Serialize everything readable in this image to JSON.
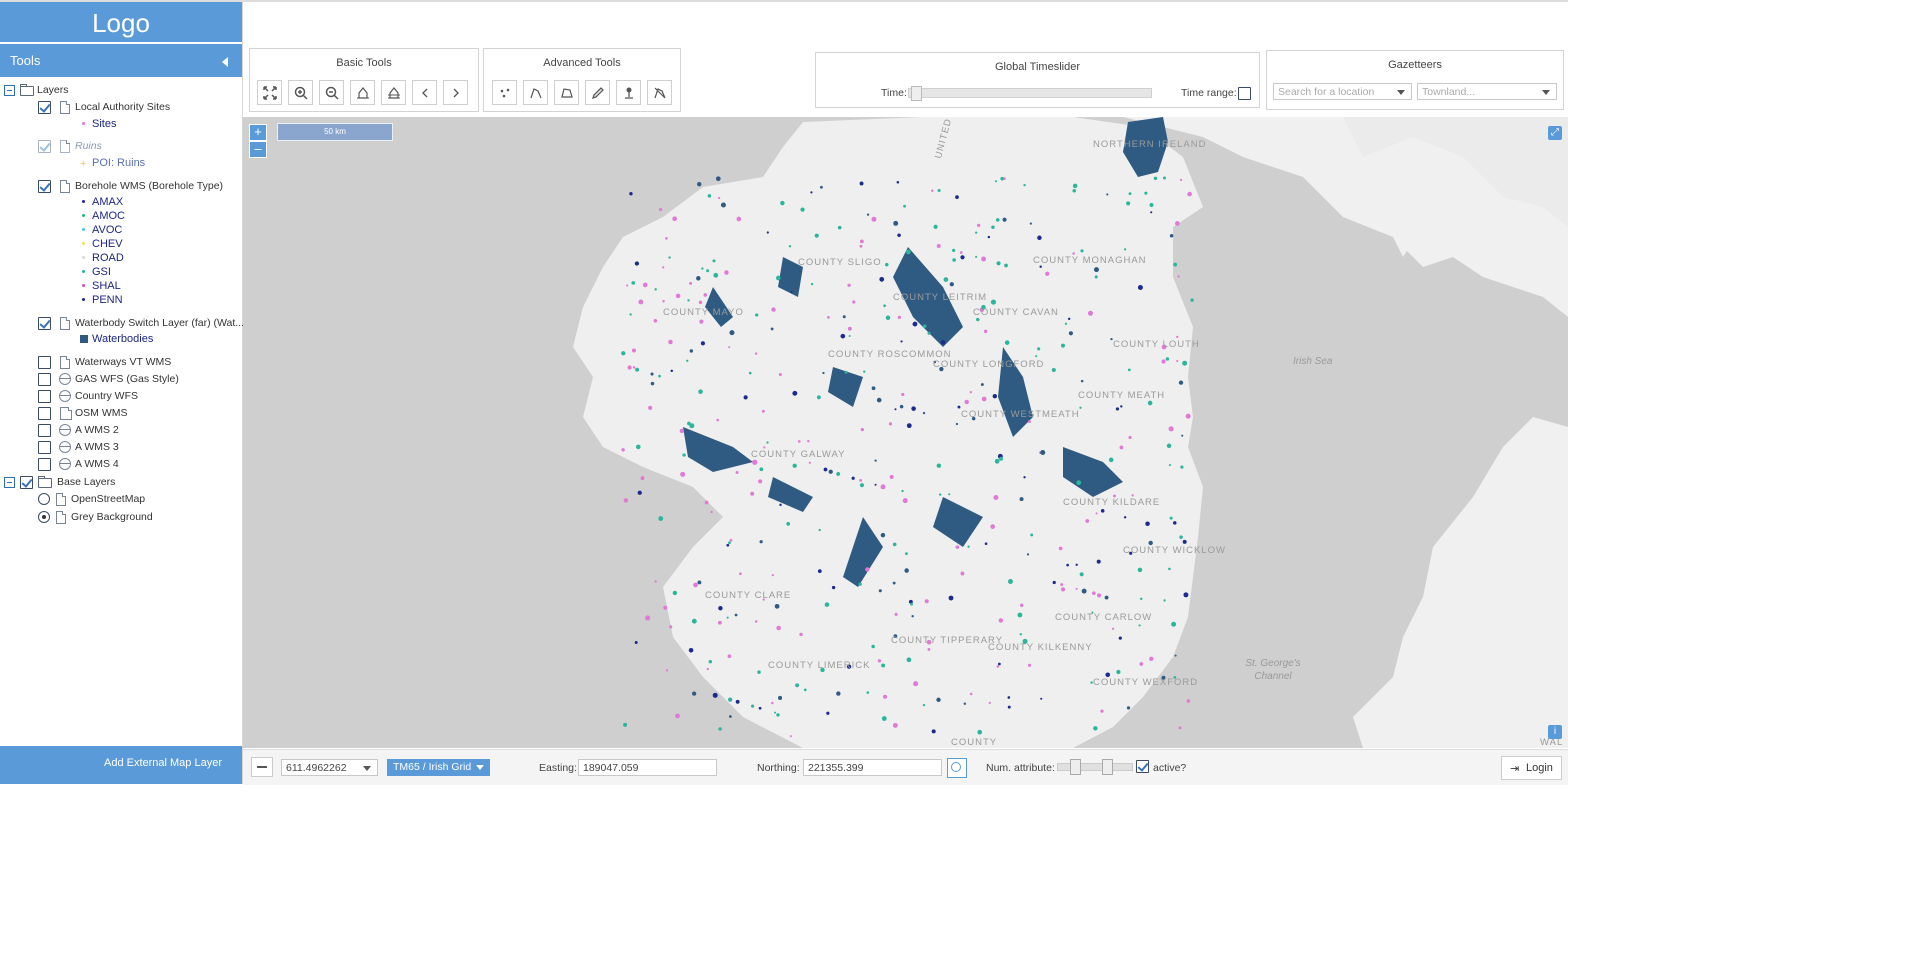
{
  "logo": "Logo",
  "sidebar": {
    "title": "Tools",
    "layers_group": "Layers",
    "layers": [
      {
        "label": "Local Authority Sites",
        "checked": true,
        "legend": [
          {
            "label": "Sites",
            "color": "#e07ad6",
            "shape": "dot"
          }
        ]
      },
      {
        "label": "Ruins",
        "checked": true,
        "dimmed": true,
        "legend": [
          {
            "label": "POI: Ruins",
            "color": "#e8c86a",
            "shape": "plus"
          }
        ]
      },
      {
        "label": "Borehole WMS (Borehole Type)",
        "checked": true,
        "legend": [
          {
            "label": "AMAX",
            "color": "#2e1f9a",
            "shape": "dot"
          },
          {
            "label": "AMOC",
            "color": "#26b872",
            "shape": "dot"
          },
          {
            "label": "AVOC",
            "color": "#47c8e0",
            "shape": "dot"
          },
          {
            "label": "CHEV",
            "color": "#f0e04a",
            "shape": "dot"
          },
          {
            "label": "ROAD",
            "color": "#d9d9d9",
            "shape": "dot"
          },
          {
            "label": "GSI",
            "color": "#2bb59c",
            "shape": "dot"
          },
          {
            "label": "SHAL",
            "color": "#d24fd0",
            "shape": "dot"
          },
          {
            "label": "PENN",
            "color": "#1b2a8c",
            "shape": "dot"
          }
        ]
      },
      {
        "label": "Waterbody Switch Layer (far) (Wat...",
        "checked": true,
        "legend": [
          {
            "label": "Waterbodies",
            "color": "#2f5b82",
            "shape": "square"
          }
        ]
      },
      {
        "label": "Waterways VT WMS",
        "checked": false,
        "icon": "doc"
      },
      {
        "label": "GAS WFS (Gas Style)",
        "checked": false,
        "icon": "globe"
      },
      {
        "label": "Country WFS",
        "checked": false,
        "icon": "globe"
      },
      {
        "label": "OSM WMS",
        "checked": false,
        "icon": "map"
      },
      {
        "label": "A WMS 2",
        "checked": false,
        "icon": "globe"
      },
      {
        "label": "A WMS 3",
        "checked": false,
        "icon": "globe"
      },
      {
        "label": "A WMS 4",
        "checked": false,
        "icon": "globe"
      }
    ],
    "base_group": "Base Layers",
    "base_layers": [
      {
        "label": "OpenStreetMap",
        "selected": false
      },
      {
        "label": "Grey Background",
        "selected": true
      }
    ],
    "add_layer_label": "Add External Map Layer"
  },
  "toolbar": {
    "basic_title": "Basic Tools",
    "basic_tools": [
      "zoom-extent-icon",
      "zoom-in-icon",
      "zoom-out-icon",
      "zoom-box-icon",
      "zoom-box-out-icon",
      "previous-view-icon",
      "next-view-icon"
    ],
    "advanced_title": "Advanced Tools",
    "advanced_tools": [
      "point-icon",
      "line-icon",
      "polygon-icon",
      "edit-icon",
      "pin-icon",
      "clear-icon"
    ],
    "timeslider": {
      "title": "Global Timeslider",
      "time_label": "Time:",
      "range_label": "Time range:",
      "range_checked": false
    },
    "gazetteers": {
      "title": "Gazetteers",
      "location_placeholder": "Search for a location",
      "townland_placeholder": "Townland..."
    }
  },
  "map": {
    "scale_label": "50 km",
    "zoom_in": "+",
    "zoom_out": "–",
    "info": "i",
    "places": [
      "NORTHERN IRELAND",
      "COUNTY SLIGO",
      "COUNTY MAYO",
      "COUNTY LEITRIM",
      "COUNTY CAVAN",
      "COUNTY MONAGHAN",
      "COUNTY LOUTH",
      "COUNTY ROSCOMMON",
      "COUNTY LONGFORD",
      "COUNTY MEATH",
      "COUNTY WESTMEATH",
      "COUNTY GALWAY",
      "COUNTY KILDARE",
      "COUNTY WICKLOW",
      "COUNTY CLARE",
      "COUNTY CARLOW",
      "COUNTY TIPPERARY",
      "COUNTY KILKENNY",
      "COUNTY LIMERICK",
      "COUNTY WEXFORD",
      "COUNTY",
      "UNITED KINGDOM",
      "WAL"
    ],
    "seas": [
      "Irish Sea",
      "St. George's Channel"
    ]
  },
  "bottombar": {
    "scale_value": "611.4962262",
    "projection": "TM65 / Irish Grid",
    "easting_label": "Easting:",
    "easting_value": "189047.059",
    "northing_label": "Northing:",
    "northing_value": "221355.399",
    "num_attr_label": "Num. attribute:",
    "active_label": "active?",
    "active_checked": true,
    "login_label": "Login"
  },
  "colors": {
    "accent": "#5a9ad9",
    "water": "#2f5b82",
    "sea": "#cfcfcf",
    "land": "#eeeeee"
  }
}
